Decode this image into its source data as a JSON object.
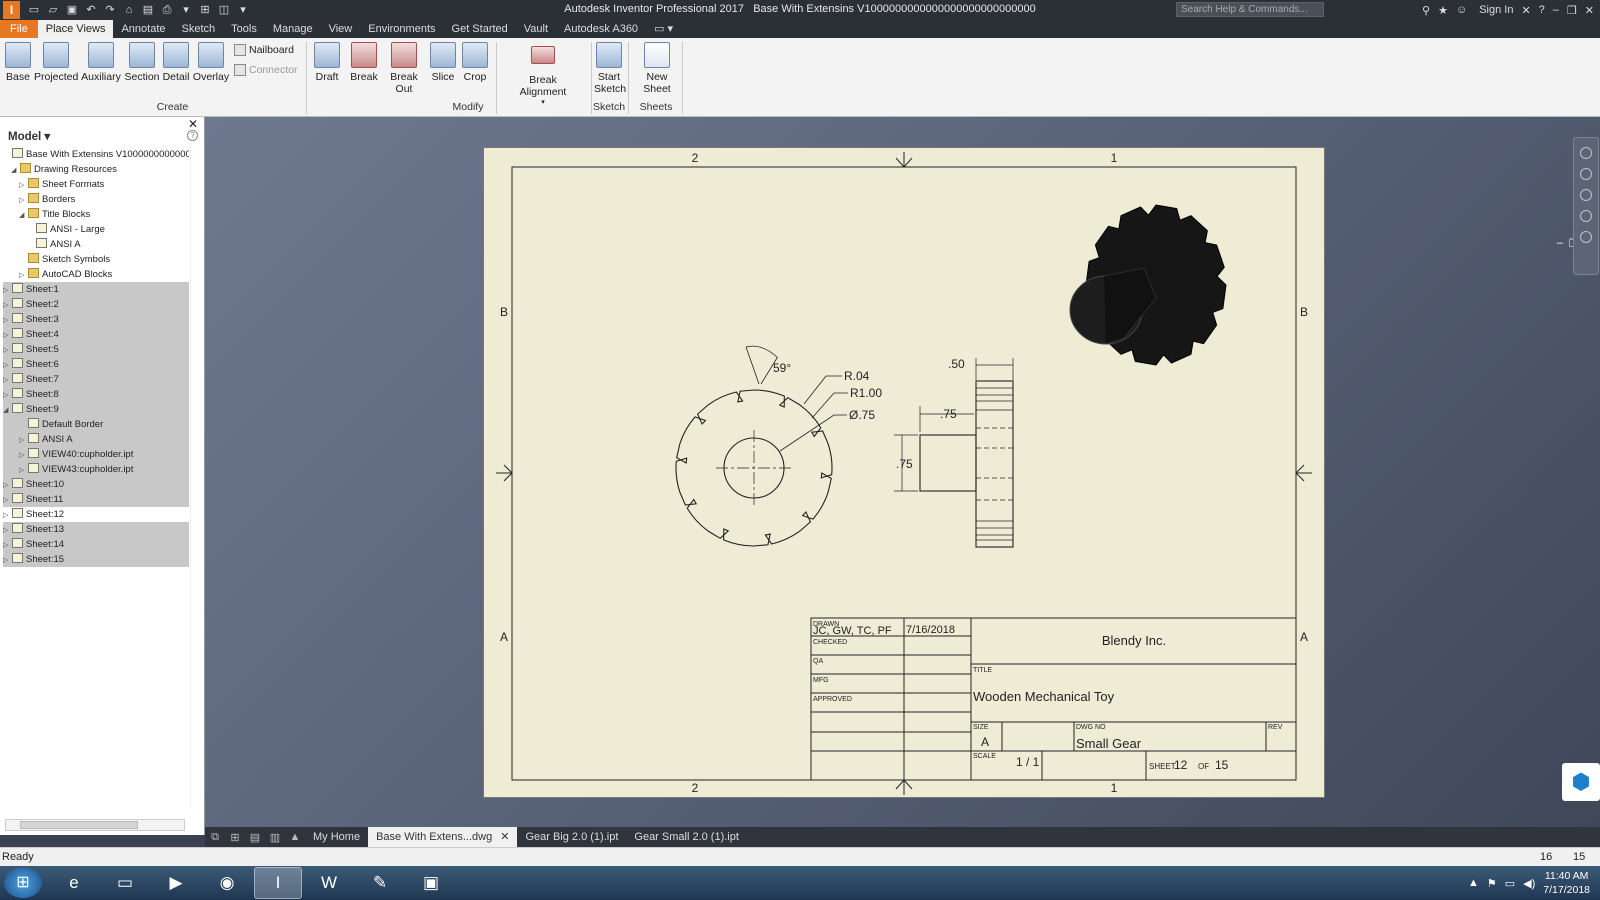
{
  "window": {
    "title": "Autodesk Inventor Professional 2017",
    "document": "Base With Extensins V1000000000000000000000000000",
    "search_placeholder": "Search Help & Commands...",
    "sign_in": "Sign In",
    "app_letter": "I"
  },
  "menu": [
    "File",
    "Place Views",
    "Annotate",
    "Sketch",
    "Tools",
    "Manage",
    "View",
    "Environments",
    "Get Started",
    "Vault",
    "Autodesk A360"
  ],
  "ribbon": {
    "create": [
      "Base",
      "Projected",
      "Auxiliary",
      "Section",
      "Detail",
      "Overlay"
    ],
    "nailboard": "Nailboard",
    "connector": "Connector",
    "modify": [
      "Draft",
      "Break",
      "Break Out",
      "Slice",
      "Crop"
    ],
    "break_alignment": "Break Alignment",
    "start_sketch": [
      "Start",
      "Sketch"
    ],
    "new_sheet": "New Sheet",
    "panels": {
      "create": "Create",
      "modify": "Modify",
      "sketch": "Sketch",
      "sheets": "Sheets"
    }
  },
  "browser": {
    "title": "Model",
    "items": [
      {
        "label": "Base With Extensins V1000000000000000000",
        "depth": 0,
        "exp": "",
        "folder": false,
        "state": ""
      },
      {
        "label": "Drawing Resources",
        "depth": 1,
        "exp": "◢",
        "folder": true,
        "state": ""
      },
      {
        "label": "Sheet Formats",
        "depth": 2,
        "exp": "▷",
        "folder": true,
        "state": ""
      },
      {
        "label": "Borders",
        "depth": 2,
        "exp": "▷",
        "folder": true,
        "state": ""
      },
      {
        "label": "Title Blocks",
        "depth": 2,
        "exp": "◢",
        "folder": true,
        "state": ""
      },
      {
        "label": "ANSI - Large",
        "depth": 3,
        "exp": "",
        "folder": false,
        "state": ""
      },
      {
        "label": "ANSI A",
        "depth": 3,
        "exp": "",
        "folder": false,
        "state": ""
      },
      {
        "label": "Sketch Symbols",
        "depth": 2,
        "exp": "",
        "folder": true,
        "state": ""
      },
      {
        "label": "AutoCAD Blocks",
        "depth": 2,
        "exp": "▷",
        "folder": true,
        "state": ""
      },
      {
        "label": "Sheet:1",
        "depth": 0,
        "exp": "▷",
        "folder": false,
        "state": "sel"
      },
      {
        "label": "Sheet:2",
        "depth": 0,
        "exp": "▷",
        "folder": false,
        "state": "sel"
      },
      {
        "label": "Sheet:3",
        "depth": 0,
        "exp": "▷",
        "folder": false,
        "state": "sel"
      },
      {
        "label": "Sheet:4",
        "depth": 0,
        "exp": "▷",
        "folder": false,
        "state": "sel"
      },
      {
        "label": "Sheet:5",
        "depth": 0,
        "exp": "▷",
        "folder": false,
        "state": "sel"
      },
      {
        "label": "Sheet:6",
        "depth": 0,
        "exp": "▷",
        "folder": false,
        "state": "sel"
      },
      {
        "label": "Sheet:7",
        "depth": 0,
        "exp": "▷",
        "folder": false,
        "state": "sel"
      },
      {
        "label": "Sheet:8",
        "depth": 0,
        "exp": "▷",
        "folder": false,
        "state": "sel"
      },
      {
        "label": "Sheet:9",
        "depth": 0,
        "exp": "◢",
        "folder": false,
        "state": "sel"
      },
      {
        "label": "Default Border",
        "depth": 2,
        "exp": "",
        "folder": false,
        "state": "sel"
      },
      {
        "label": "ANSI A",
        "depth": 2,
        "exp": "▷",
        "folder": false,
        "state": "sel"
      },
      {
        "label": "VIEW40:cupholder.ipt",
        "depth": 2,
        "exp": "▷",
        "folder": false,
        "state": "sel"
      },
      {
        "label": "VIEW43:cupholder.ipt",
        "depth": 2,
        "exp": "▷",
        "folder": false,
        "state": "sel"
      },
      {
        "label": "Sheet:10",
        "depth": 0,
        "exp": "▷",
        "folder": false,
        "state": "sel"
      },
      {
        "label": "Sheet:11",
        "depth": 0,
        "exp": "▷",
        "folder": false,
        "state": "sel"
      },
      {
        "label": "Sheet:12",
        "depth": 0,
        "exp": "▷",
        "folder": false,
        "state": "cur"
      },
      {
        "label": "Sheet:13",
        "depth": 0,
        "exp": "▷",
        "folder": false,
        "state": "sel"
      },
      {
        "label": "Sheet:14",
        "depth": 0,
        "exp": "▷",
        "folder": false,
        "state": "sel"
      },
      {
        "label": "Sheet:15",
        "depth": 0,
        "exp": "▷",
        "folder": false,
        "state": "sel"
      }
    ]
  },
  "drawing": {
    "zone_top_left": "2",
    "zone_top_right": "1",
    "zone_bottom_left": "2",
    "zone_bottom_right": "1",
    "zone_b": "B",
    "zone_a": "A",
    "dims": {
      "angle": "59°",
      "r_small": "R.04",
      "r_large": "R1.00",
      "dia": "Ø.75",
      "width_top": ".50",
      "hub_len": ".75",
      "hub_dia": ".75"
    },
    "title_block": {
      "drawn_label": "DRAWN",
      "drawn_by": "JC, GW, TC, PF",
      "drawn_date": "7/16/2018",
      "checked_label": "CHECKED",
      "qa_label": "QA",
      "mfg_label": "MFG",
      "approved_label": "APPROVED",
      "company": "Blendy Inc.",
      "title_label": "TITLE",
      "title": "Wooden Mechanical Toy",
      "size_label": "SIZE",
      "size": "A",
      "dwgno_label": "DWG NO",
      "dwg_no": "Small Gear",
      "rev_label": "REV",
      "scale_label": "SCALE",
      "scale": "1 / 1",
      "sheet_label": "SHEET",
      "sheet_no": "12",
      "of_label": "OF",
      "sheet_total": "15"
    }
  },
  "doc_tabs": [
    "My Home",
    "Base With Extens...dwg",
    "Gear Big 2.0 (1).ipt",
    "Gear Small 2.0 (1).ipt"
  ],
  "status": {
    "text": "Ready",
    "n1": "16",
    "n2": "15"
  },
  "clock": {
    "time": "11:40 AM",
    "date": "7/17/2018"
  }
}
